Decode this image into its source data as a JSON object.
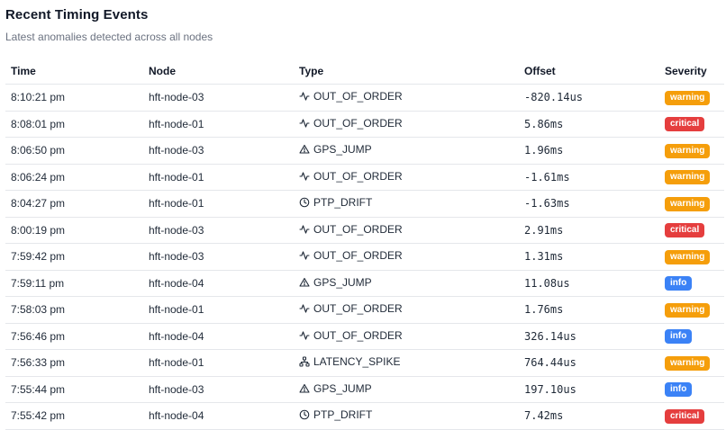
{
  "header": {
    "title": "Recent Timing Events",
    "subtitle": "Latest anomalies detected across all nodes"
  },
  "columns": {
    "time": "Time",
    "node": "Node",
    "type": "Type",
    "offset": "Offset",
    "severity": "Severity"
  },
  "colors": {
    "warning": "#f59e0b",
    "critical": "#e53e3e",
    "info": "#3b82f6"
  },
  "type_icons": {
    "OUT_OF_ORDER": "activity-icon",
    "GPS_JUMP": "alert-triangle-icon",
    "PTP_DRIFT": "clock-icon",
    "LATENCY_SPIKE": "network-icon"
  },
  "rows": [
    {
      "time": "8:10:21 pm",
      "node": "hft-node-03",
      "type": "OUT_OF_ORDER",
      "offset": "-820.14us",
      "severity": "warning"
    },
    {
      "time": "8:08:01 pm",
      "node": "hft-node-01",
      "type": "OUT_OF_ORDER",
      "offset": "5.86ms",
      "severity": "critical"
    },
    {
      "time": "8:06:50 pm",
      "node": "hft-node-03",
      "type": "GPS_JUMP",
      "offset": "1.96ms",
      "severity": "warning"
    },
    {
      "time": "8:06:24 pm",
      "node": "hft-node-01",
      "type": "OUT_OF_ORDER",
      "offset": "-1.61ms",
      "severity": "warning"
    },
    {
      "time": "8:04:27 pm",
      "node": "hft-node-01",
      "type": "PTP_DRIFT",
      "offset": "-1.63ms",
      "severity": "warning"
    },
    {
      "time": "8:00:19 pm",
      "node": "hft-node-03",
      "type": "OUT_OF_ORDER",
      "offset": "2.91ms",
      "severity": "critical"
    },
    {
      "time": "7:59:42 pm",
      "node": "hft-node-03",
      "type": "OUT_OF_ORDER",
      "offset": "1.31ms",
      "severity": "warning"
    },
    {
      "time": "7:59:11 pm",
      "node": "hft-node-04",
      "type": "GPS_JUMP",
      "offset": "11.08us",
      "severity": "info"
    },
    {
      "time": "7:58:03 pm",
      "node": "hft-node-01",
      "type": "OUT_OF_ORDER",
      "offset": "1.76ms",
      "severity": "warning"
    },
    {
      "time": "7:56:46 pm",
      "node": "hft-node-04",
      "type": "OUT_OF_ORDER",
      "offset": "326.14us",
      "severity": "info"
    },
    {
      "time": "7:56:33 pm",
      "node": "hft-node-01",
      "type": "LATENCY_SPIKE",
      "offset": "764.44us",
      "severity": "warning"
    },
    {
      "time": "7:55:44 pm",
      "node": "hft-node-03",
      "type": "GPS_JUMP",
      "offset": "197.10us",
      "severity": "info"
    },
    {
      "time": "7:55:42 pm",
      "node": "hft-node-04",
      "type": "PTP_DRIFT",
      "offset": "7.42ms",
      "severity": "critical"
    }
  ]
}
